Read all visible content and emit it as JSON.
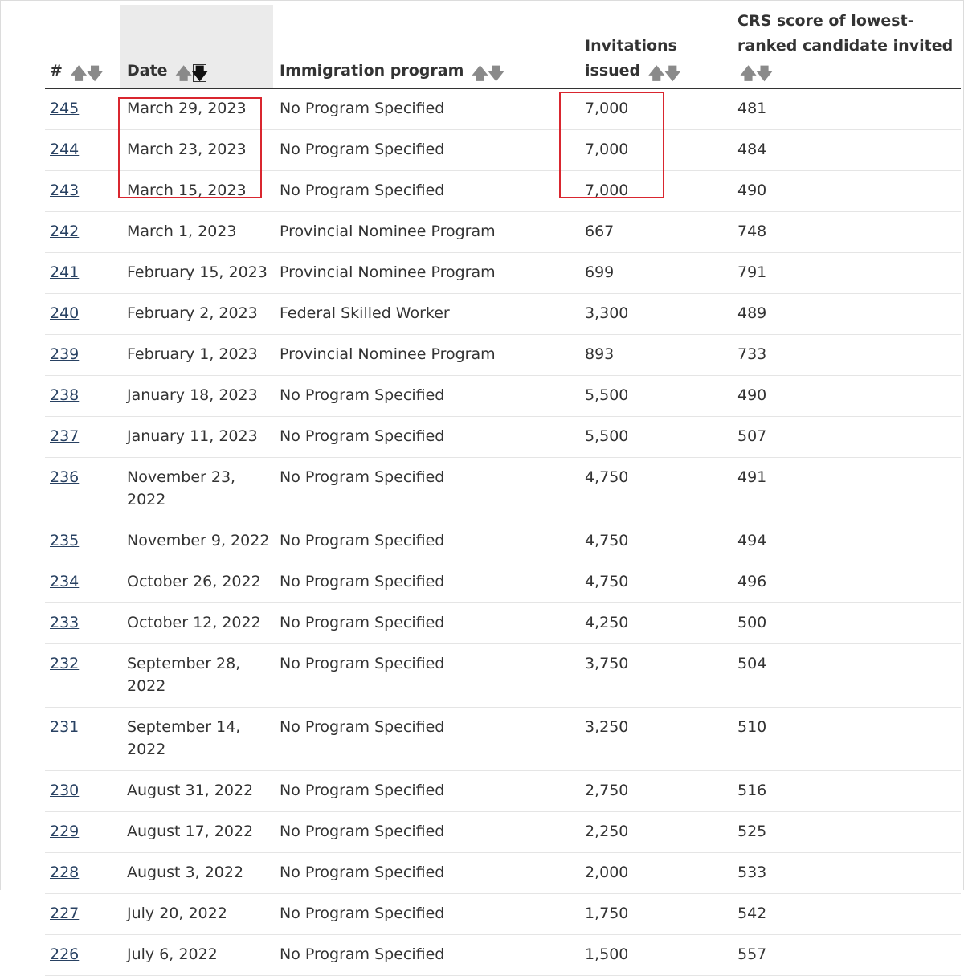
{
  "table": {
    "headers": {
      "num": "#",
      "date": "Date",
      "program": "Immigration program",
      "invitations": "Invitations issued",
      "crs": "CRS score of lowest-ranked candidate invited"
    },
    "sort_icons": {
      "up": "sort-ascending-arrow-icon",
      "down": "sort-descending-arrow-icon"
    },
    "sorted_column": "date",
    "sorted_direction": "descending",
    "rows": [
      {
        "num": "245",
        "date": "March 29, 2023",
        "program": "No Program Specified",
        "invitations": "7,000",
        "crs": "481"
      },
      {
        "num": "244",
        "date": "March 23, 2023",
        "program": "No Program Specified",
        "invitations": "7,000",
        "crs": "484"
      },
      {
        "num": "243",
        "date": "March 15, 2023",
        "program": "No Program Specified",
        "invitations": "7,000",
        "crs": "490"
      },
      {
        "num": "242",
        "date": "March 1, 2023",
        "program": "Provincial Nominee Program",
        "invitations": "667",
        "crs": "748"
      },
      {
        "num": "241",
        "date": "February 15, 2023",
        "program": "Provincial Nominee Program",
        "invitations": "699",
        "crs": "791"
      },
      {
        "num": "240",
        "date": "February 2, 2023",
        "program": "Federal Skilled Worker",
        "invitations": "3,300",
        "crs": "489"
      },
      {
        "num": "239",
        "date": "February 1, 2023",
        "program": "Provincial Nominee Program",
        "invitations": "893",
        "crs": "733"
      },
      {
        "num": "238",
        "date": "January 18, 2023",
        "program": "No Program Specified",
        "invitations": "5,500",
        "crs": "490"
      },
      {
        "num": "237",
        "date": "January 11, 2023",
        "program": "No Program Specified",
        "invitations": "5,500",
        "crs": "507"
      },
      {
        "num": "236",
        "date": "November 23, 2022",
        "program": "No Program Specified",
        "invitations": "4,750",
        "crs": "491"
      },
      {
        "num": "235",
        "date": "November 9, 2022",
        "program": "No Program Specified",
        "invitations": "4,750",
        "crs": "494"
      },
      {
        "num": "234",
        "date": "October 26, 2022",
        "program": "No Program Specified",
        "invitations": "4,750",
        "crs": "496"
      },
      {
        "num": "233",
        "date": "October 12, 2022",
        "program": "No Program Specified",
        "invitations": "4,250",
        "crs": "500"
      },
      {
        "num": "232",
        "date": "September 28, 2022",
        "program": "No Program Specified",
        "invitations": "3,750",
        "crs": "504"
      },
      {
        "num": "231",
        "date": "September 14, 2022",
        "program": "No Program Specified",
        "invitations": "3,250",
        "crs": "510"
      },
      {
        "num": "230",
        "date": "August 31, 2022",
        "program": "No Program Specified",
        "invitations": "2,750",
        "crs": "516"
      },
      {
        "num": "229",
        "date": "August 17, 2022",
        "program": "No Program Specified",
        "invitations": "2,250",
        "crs": "525"
      },
      {
        "num": "228",
        "date": "August 3, 2022",
        "program": "No Program Specified",
        "invitations": "2,000",
        "crs": "533"
      },
      {
        "num": "227",
        "date": "July 20, 2022",
        "program": "No Program Specified",
        "invitations": "1,750",
        "crs": "542"
      },
      {
        "num": "226",
        "date": "July 6, 2022",
        "program": "No Program Specified",
        "invitations": "1,500",
        "crs": "557"
      }
    ]
  },
  "annotations": {
    "highlight_color": "#d9262f",
    "highlighted_columns": [
      "date",
      "invitations"
    ],
    "highlighted_rows": [
      "245",
      "244",
      "243"
    ]
  }
}
